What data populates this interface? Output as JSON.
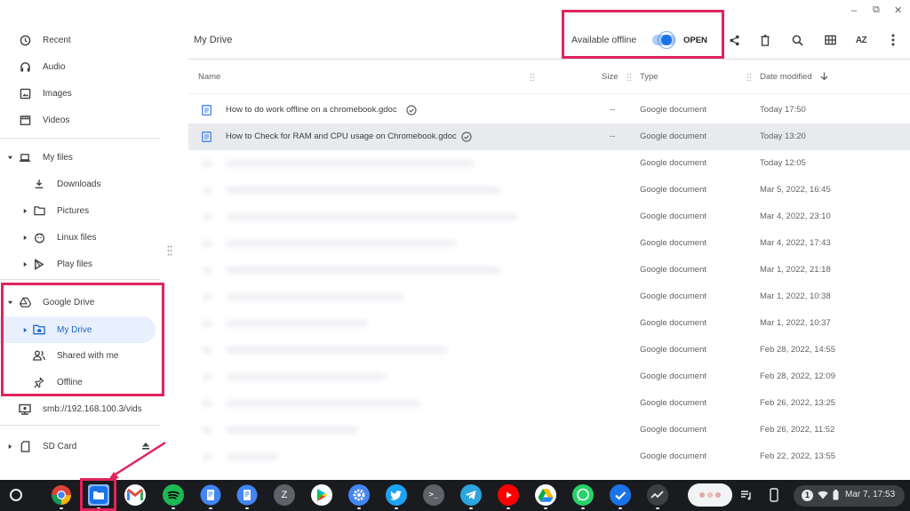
{
  "window": {
    "controls": {
      "minimize": "–",
      "restore": "⧉",
      "close": "✕"
    }
  },
  "sidebar": {
    "recent": "Recent",
    "audio": "Audio",
    "images": "Images",
    "videos": "Videos",
    "my_files": "My files",
    "downloads": "Downloads",
    "pictures": "Pictures",
    "linux_files": "Linux files",
    "play_files": "Play files",
    "google_drive": "Google Drive",
    "my_drive": "My Drive",
    "shared_with_me": "Shared with me",
    "offline": "Offline",
    "smb": "smb://192.168.100.3/vids",
    "sd_card": "SD Card"
  },
  "header": {
    "title": "My Drive",
    "available_offline": "Available offline",
    "open_label": "OPEN",
    "sort_icon_text": "AZ"
  },
  "columns": {
    "name": "Name",
    "size": "Size",
    "type": "Type",
    "date_modified": "Date modified"
  },
  "files": [
    {
      "name": "How to do work offline on a chromebook.gdoc",
      "size": "--",
      "type": "Google document",
      "date": "Today 17:50"
    },
    {
      "name": "How to Check for RAM and CPU usage on Chromebook.gdoc",
      "size": "--",
      "type": "Google document",
      "date": "Today 13:20"
    },
    {
      "name": "",
      "size": "",
      "type": "Google document",
      "date": "Today 12:05"
    },
    {
      "name": "",
      "size": "",
      "type": "Google document",
      "date": "Mar 5, 2022, 16:45"
    },
    {
      "name": "",
      "size": "",
      "type": "Google document",
      "date": "Mar 4, 2022, 23:10"
    },
    {
      "name": "",
      "size": "",
      "type": "Google document",
      "date": "Mar 4, 2022, 17:43"
    },
    {
      "name": "",
      "size": "",
      "type": "Google document",
      "date": "Mar 1, 2022, 21:18"
    },
    {
      "name": "",
      "size": "",
      "type": "Google document",
      "date": "Mar 1, 2022, 10:38"
    },
    {
      "name": "",
      "size": "",
      "type": "Google document",
      "date": "Mar 1, 2022, 10:37"
    },
    {
      "name": "",
      "size": "",
      "type": "Google document",
      "date": "Feb 28, 2022, 14:55"
    },
    {
      "name": "",
      "size": "",
      "type": "Google document",
      "date": "Feb 28, 2022, 12:09"
    },
    {
      "name": "",
      "size": "",
      "type": "Google document",
      "date": "Feb 26, 2022, 13:25"
    },
    {
      "name": "",
      "size": "",
      "type": "Google document",
      "date": "Feb 26, 2022, 11:52"
    },
    {
      "name": "",
      "size": "",
      "type": "Google document",
      "date": "Feb 22, 2022, 13:55"
    }
  ],
  "taskbar": {
    "apps": [
      "launcher-icon",
      "chrome-icon",
      "files-icon",
      "gmail-icon",
      "spotify-icon",
      "docs-icon",
      "docs-icon-2",
      "zoom-icon",
      "play-store-icon",
      "settings-icon",
      "twitter-icon",
      "terminal-icon",
      "telegram-icon",
      "youtube-icon",
      "drive-icon",
      "whatsapp-icon",
      "tasks-icon",
      "analytics-icon"
    ],
    "zoom_letter": "Z",
    "terminal_text": ">_",
    "notification_count": "1",
    "clock": "Mar 7, 17:53"
  },
  "colors": {
    "highlight": "#e0245e",
    "accent": "#1a73e8",
    "selected_row": "#e8eaed",
    "shelf": "#1a1b1f"
  }
}
